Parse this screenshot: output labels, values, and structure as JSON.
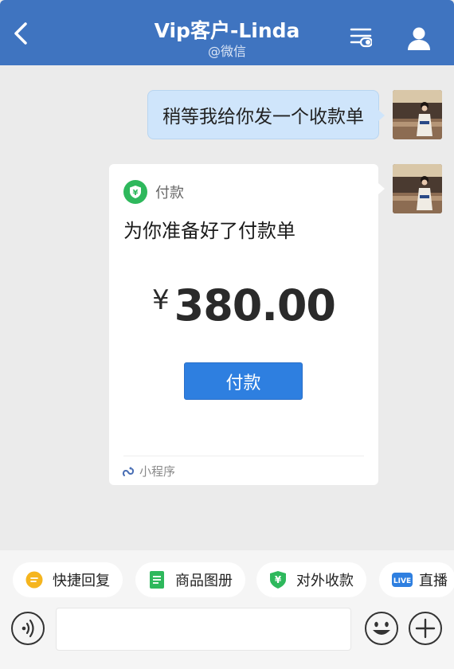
{
  "header": {
    "title": "Vip客户-Linda",
    "subtitle": "@微信",
    "background": "#3f74c0"
  },
  "messages": {
    "text_message": "稍等我给你发一个收款单",
    "payment_card": {
      "label": "付款",
      "title": "为你准备好了付款单",
      "currency": "¥",
      "amount": "380.00",
      "button_label": "付款",
      "footer": "小程序"
    }
  },
  "quick_actions": [
    {
      "label": "快捷回复",
      "icon": "quick-reply-icon",
      "color": "#f5b51e"
    },
    {
      "label": "商品图册",
      "icon": "product-album-icon",
      "color": "#2eb85c"
    },
    {
      "label": "对外收款",
      "icon": "payment-shield-icon",
      "color": "#2eb85c"
    },
    {
      "label": "直播",
      "icon": "live-icon",
      "color": "#2e7fe0"
    }
  ],
  "input": {
    "value": "",
    "placeholder": ""
  },
  "colors": {
    "accent": "#2e7fe0",
    "pay_green": "#2eb85c",
    "bubble": "#cfe5fb",
    "chat_background": "#ebebeb"
  }
}
